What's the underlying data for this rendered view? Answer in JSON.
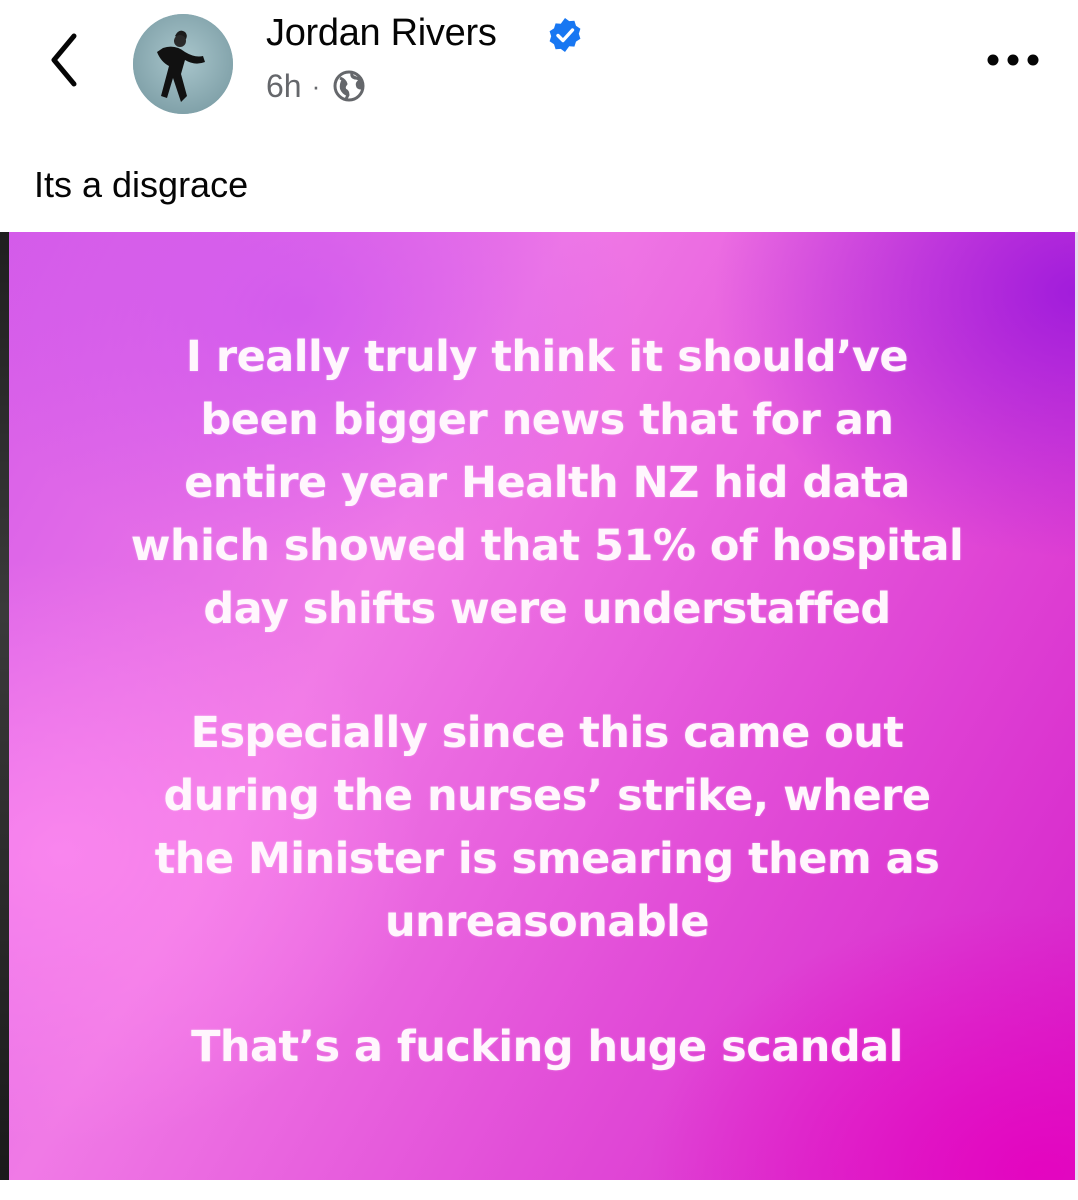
{
  "post": {
    "author": "Jordan Rivers",
    "time": "6h",
    "separator": "·",
    "audience_icon": "globe-icon",
    "verified_icon": "verified-badge-icon",
    "caption": "Its a disgrace"
  },
  "story_image": {
    "paragraphs": [
      [
        "I really truly think it should’ve",
        "been bigger news that for an",
        "entire year Health NZ hid data",
        "which showed that 51% of hospital",
        "day shifts were understaffed"
      ],
      [
        "Especially since this came out",
        "during the nurses’ strike, where",
        "the Minister is smearing them as",
        "unreasonable"
      ],
      [
        "That’s a fucking huge scandal"
      ]
    ]
  },
  "icons": {
    "back": "chevron-left-icon",
    "more": "more-options-icon"
  },
  "colors": {
    "verified": "#1877f2",
    "secondary_text": "#65676b",
    "primary_text": "#050505",
    "image_pink": "#f07ae6",
    "image_purple": "#9614dc",
    "image_magenta": "#e600be"
  }
}
